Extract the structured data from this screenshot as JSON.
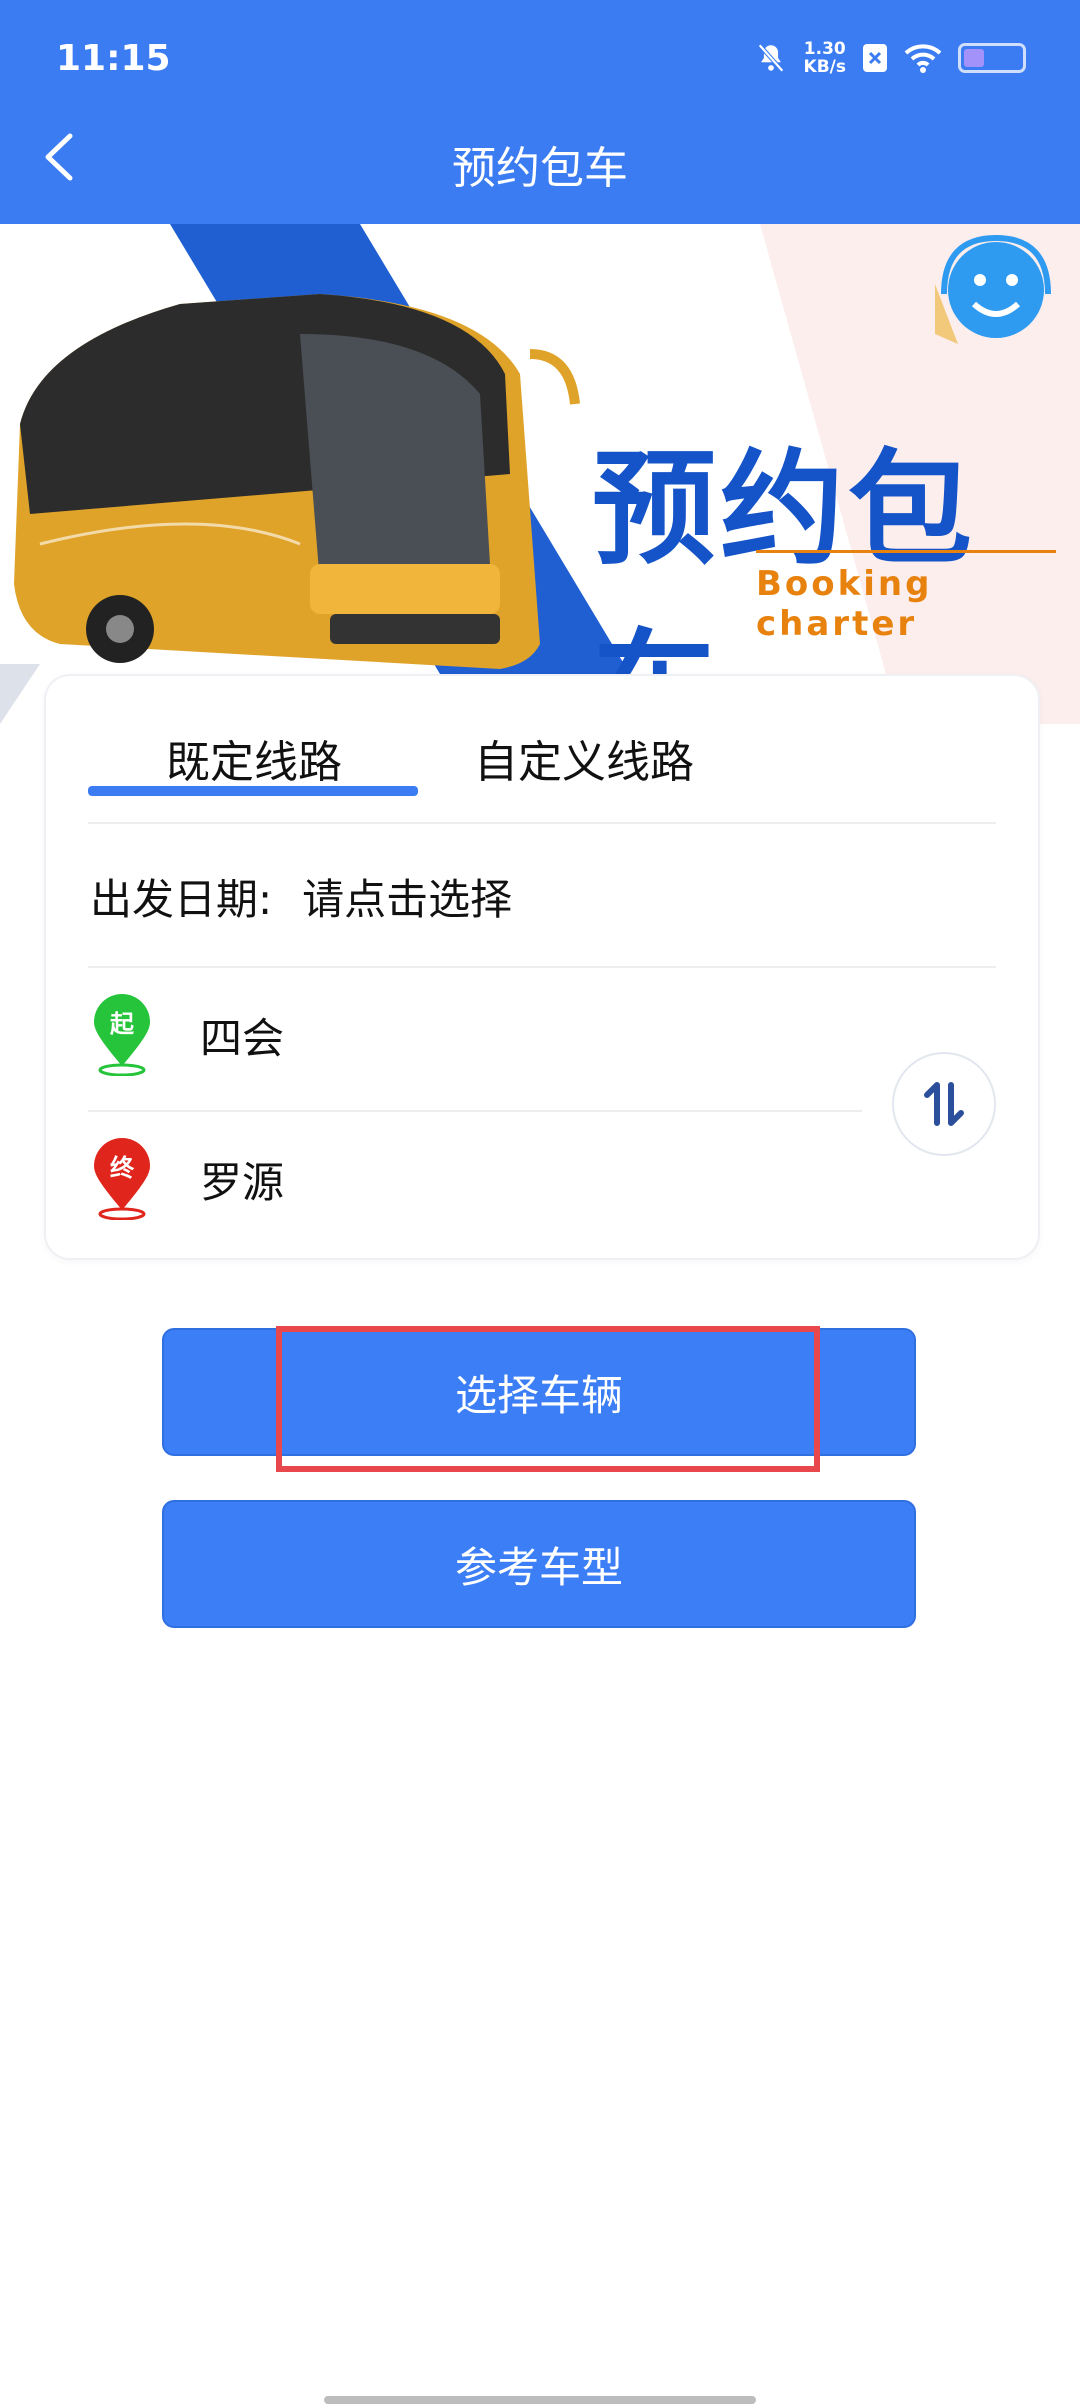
{
  "status_bar": {
    "time": "11:15",
    "speed_value": "1.30",
    "speed_unit": "KB/s",
    "battery_level": 0.35
  },
  "header": {
    "title": "预约包车"
  },
  "banner": {
    "title": "预约包车",
    "subtitle": "Booking charter"
  },
  "tabs": [
    "既定线路",
    "自定义线路"
  ],
  "form": {
    "date_label": "出发日期:",
    "date_value": "请点击选择",
    "start_badge": "起",
    "start_name": "四会",
    "end_badge": "终",
    "end_name": "罗源"
  },
  "buttons": {
    "select_vehicle": "选择车辆",
    "reference_model": "参考车型"
  },
  "colors": {
    "primary": "#3c7cf2",
    "start_pin": "#26c43a",
    "end_pin": "#e0261c",
    "highlight": "#e8474c"
  }
}
